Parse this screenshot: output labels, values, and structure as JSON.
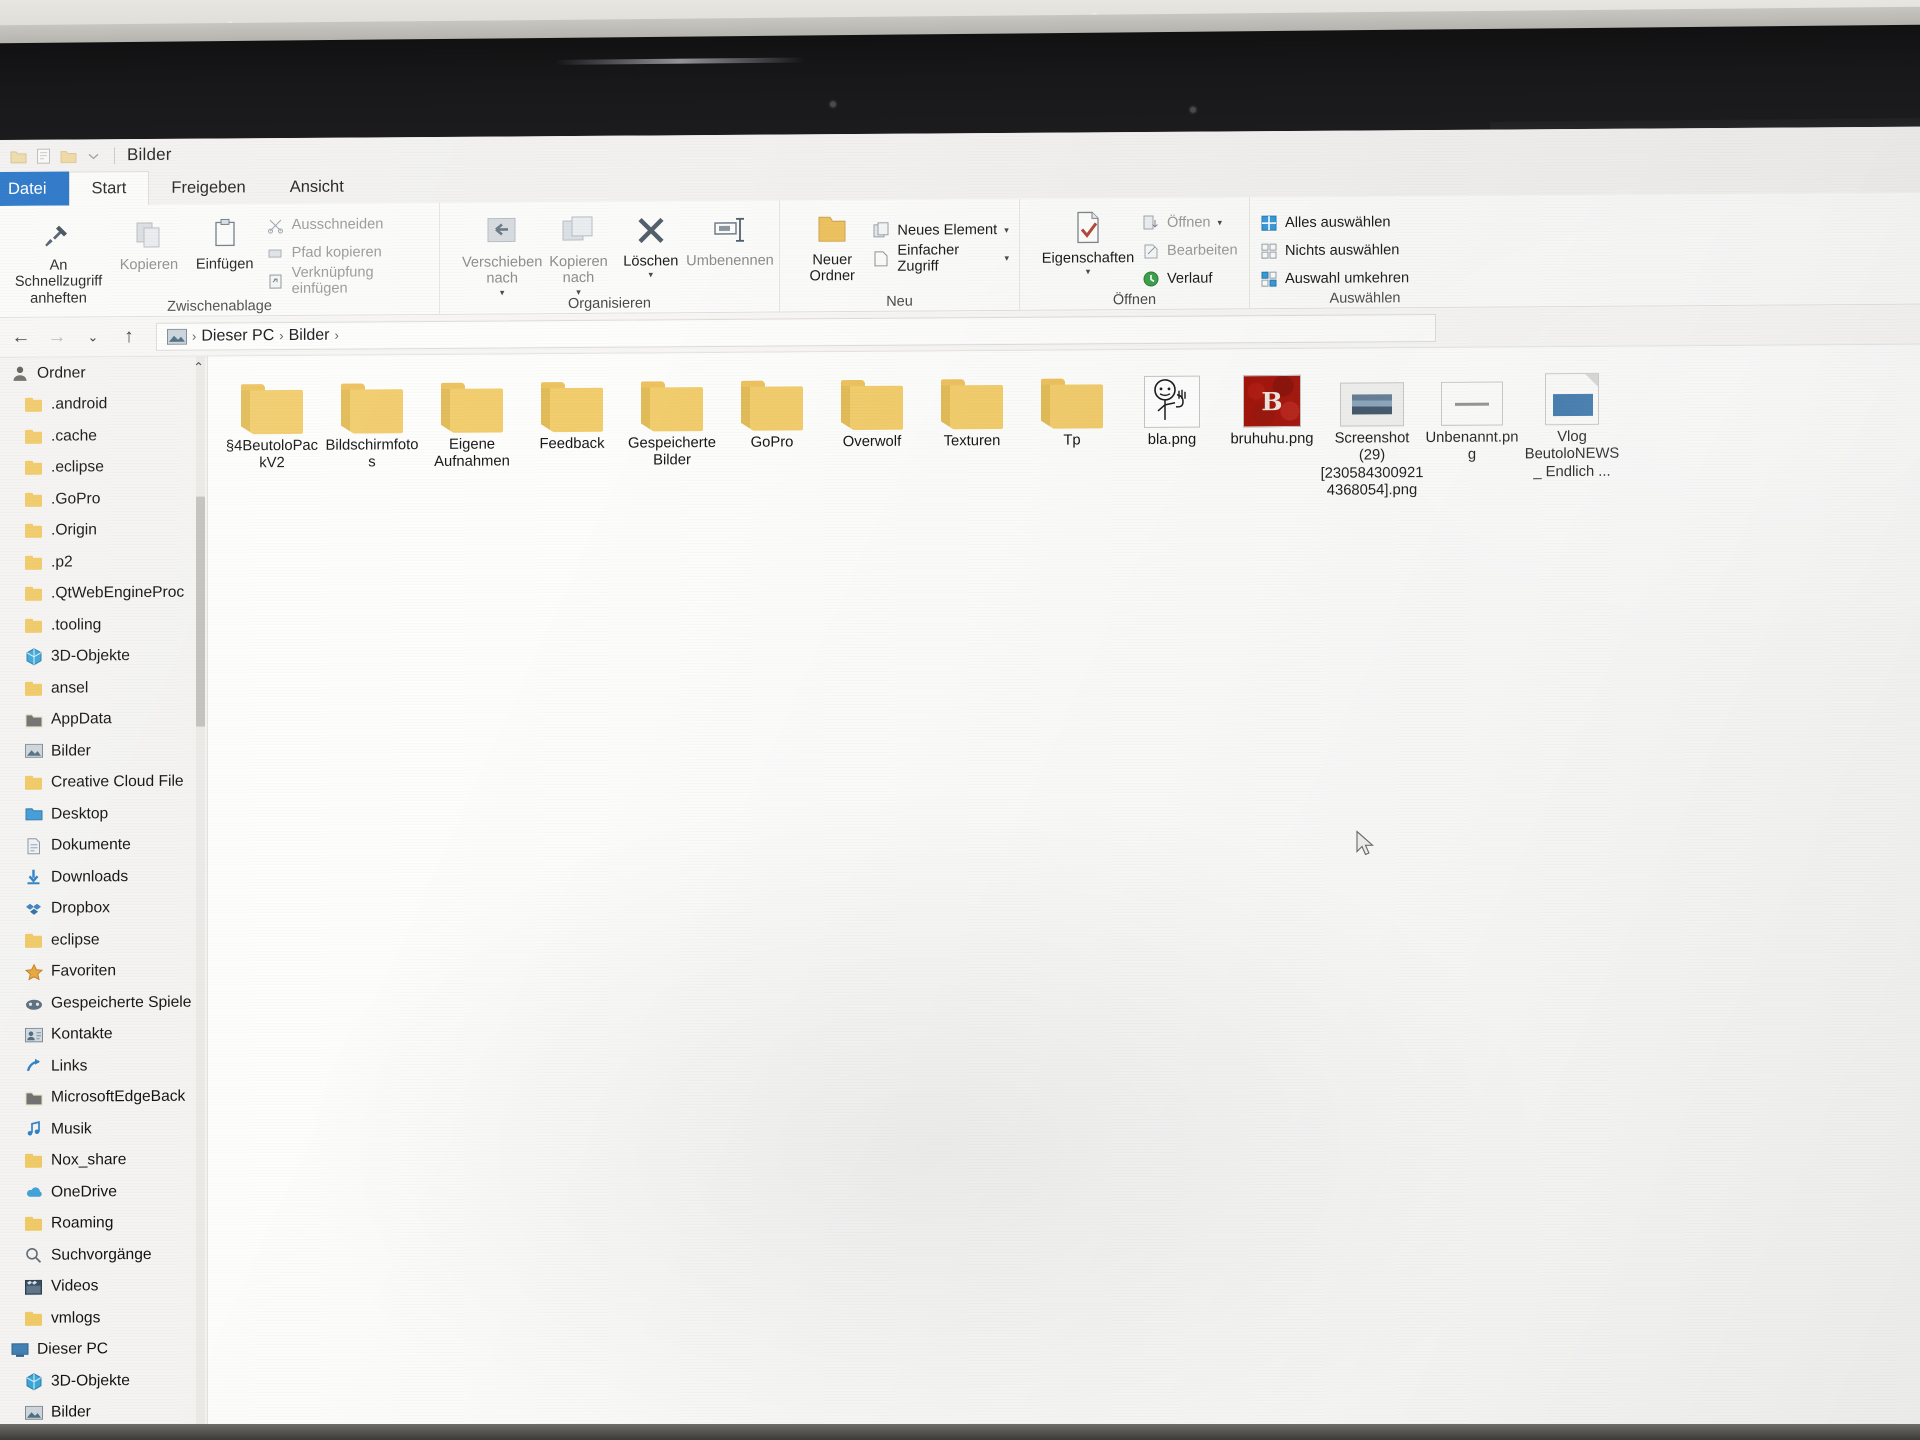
{
  "window": {
    "title": "Bilder",
    "qat_icons": [
      "folder-icon",
      "properties-icon",
      "new-folder-icon",
      "dropdown-caret-icon"
    ]
  },
  "tabs": [
    {
      "label": "Datei",
      "state": "file"
    },
    {
      "label": "Start",
      "state": "active"
    },
    {
      "label": "Freigeben",
      "state": "normal"
    },
    {
      "label": "Ansicht",
      "state": "normal"
    }
  ],
  "ribbon": {
    "groups": [
      {
        "label": "Zwischenablage",
        "big": [
          {
            "label": "An Schnellzugriff anheften",
            "icon": "pin-icon",
            "disabled": false
          },
          {
            "label": "Kopieren",
            "icon": "copy-icon",
            "disabled": true
          },
          {
            "label": "Einfügen",
            "icon": "paste-icon",
            "disabled": false
          }
        ],
        "small": [
          {
            "label": "Ausschneiden",
            "icon": "scissors-icon",
            "disabled": true
          },
          {
            "label": "Pfad kopieren",
            "icon": "copy-path-icon",
            "disabled": true
          },
          {
            "label": "Verknüpfung einfügen",
            "icon": "paste-shortcut-icon",
            "disabled": true
          }
        ]
      },
      {
        "label": "Organisieren",
        "big": [
          {
            "label": "Verschieben nach",
            "icon": "move-to-icon",
            "caret": true,
            "disabled": true
          },
          {
            "label": "Kopieren nach",
            "icon": "copy-to-icon",
            "caret": true,
            "disabled": true
          },
          {
            "label": "Löschen",
            "icon": "delete-x-icon",
            "caret": true,
            "disabled": false
          },
          {
            "label": "Umbenennen",
            "icon": "rename-icon",
            "disabled": true
          }
        ],
        "small": []
      },
      {
        "label": "Neu",
        "big": [
          {
            "label": "Neuer Ordner",
            "icon": "new-folder-icon",
            "disabled": false
          }
        ],
        "small": [
          {
            "label": "Neues Element",
            "icon": "new-item-icon",
            "caret": true,
            "disabled": false
          },
          {
            "label": "Einfacher Zugriff",
            "icon": "easy-access-icon",
            "caret": true,
            "disabled": false
          }
        ]
      },
      {
        "label": "Öffnen",
        "big": [
          {
            "label": "Eigenschaften",
            "icon": "properties-check-icon",
            "caret": true,
            "disabled": false
          }
        ],
        "small": [
          {
            "label": "Öffnen",
            "icon": "open-icon",
            "caret": true,
            "disabled": true
          },
          {
            "label": "Bearbeiten",
            "icon": "edit-icon",
            "disabled": true
          },
          {
            "label": "Verlauf",
            "icon": "history-icon",
            "disabled": false
          }
        ]
      },
      {
        "label": "Auswählen",
        "big": [],
        "small": [
          {
            "label": "Alles auswählen",
            "icon": "select-all-icon",
            "disabled": false
          },
          {
            "label": "Nichts auswählen",
            "icon": "select-none-icon",
            "disabled": false
          },
          {
            "label": "Auswahl umkehren",
            "icon": "invert-selection-icon",
            "disabled": false
          }
        ]
      }
    ]
  },
  "address_bar": {
    "back_icon": "back-arrow-icon",
    "forward_icon": "forward-arrow-icon",
    "recent_icon": "recent-locations-caret-icon",
    "up_icon": "up-arrow-icon",
    "location_icon": "pictures-icon",
    "crumbs": [
      "Dieser PC",
      "Bilder"
    ],
    "separator": "›"
  },
  "nav_pane": {
    "root_label": "Ordner",
    "root_icon": "user-folder-icon",
    "items": [
      {
        "label": ".android",
        "icon": "folder-icon"
      },
      {
        "label": ".cache",
        "icon": "folder-icon"
      },
      {
        "label": ".eclipse",
        "icon": "folder-icon"
      },
      {
        "label": ".GoPro",
        "icon": "folder-icon"
      },
      {
        "label": ".Origin",
        "icon": "folder-icon"
      },
      {
        "label": ".p2",
        "icon": "folder-icon"
      },
      {
        "label": ".QtWebEngineProc",
        "icon": "folder-icon"
      },
      {
        "label": ".tooling",
        "icon": "folder-icon"
      },
      {
        "label": "3D-Objekte",
        "icon": "3d-objects-icon"
      },
      {
        "label": "ansel",
        "icon": "folder-icon"
      },
      {
        "label": "AppData",
        "icon": "folder-hidden-icon"
      },
      {
        "label": "Bilder",
        "icon": "pictures-icon"
      },
      {
        "label": "Creative Cloud File",
        "icon": "folder-icon"
      },
      {
        "label": "Desktop",
        "icon": "desktop-icon"
      },
      {
        "label": "Dokumente",
        "icon": "documents-icon"
      },
      {
        "label": "Downloads",
        "icon": "downloads-icon"
      },
      {
        "label": "Dropbox",
        "icon": "dropbox-icon"
      },
      {
        "label": "eclipse",
        "icon": "folder-icon"
      },
      {
        "label": "Favoriten",
        "icon": "favorites-star-icon"
      },
      {
        "label": "Gespeicherte Spiele",
        "icon": "saved-games-icon"
      },
      {
        "label": "Kontakte",
        "icon": "contacts-icon"
      },
      {
        "label": "Links",
        "icon": "links-icon"
      },
      {
        "label": "MicrosoftEdgeBack",
        "icon": "folder-hidden-icon"
      },
      {
        "label": "Musik",
        "icon": "music-icon"
      },
      {
        "label": "Nox_share",
        "icon": "folder-icon"
      },
      {
        "label": "OneDrive",
        "icon": "onedrive-icon"
      },
      {
        "label": "Roaming",
        "icon": "folder-icon"
      },
      {
        "label": "Suchvorgänge",
        "icon": "searches-icon"
      },
      {
        "label": "Videos",
        "icon": "videos-icon"
      },
      {
        "label": "vmlogs",
        "icon": "folder-icon"
      },
      {
        "label": "Dieser PC",
        "icon": "this-pc-icon"
      },
      {
        "label": "3D-Objekte",
        "icon": "3d-objects-icon"
      },
      {
        "label": "Bilder",
        "icon": "pictures-icon"
      }
    ]
  },
  "content": {
    "items": [
      {
        "name": "§4BeutoloPackV2",
        "kind": "folder"
      },
      {
        "name": "Bildschirmfotos",
        "kind": "folder"
      },
      {
        "name": "Eigene Aufnahmen",
        "kind": "folder"
      },
      {
        "name": "Feedback",
        "kind": "folder"
      },
      {
        "name": "Gespeicherte Bilder",
        "kind": "folder"
      },
      {
        "name": "GoPro",
        "kind": "folder"
      },
      {
        "name": "Overwolf",
        "kind": "folder"
      },
      {
        "name": "Texturen",
        "kind": "folder"
      },
      {
        "name": "Tp",
        "kind": "folder"
      },
      {
        "name": "bla.png",
        "kind": "image-sketch"
      },
      {
        "name": "bruhuhu.png",
        "kind": "image-red",
        "glyph": "B"
      },
      {
        "name": "Screenshot (29)[2305843009214368054].png",
        "kind": "image-screenshot"
      },
      {
        "name": "Unbenannt.png",
        "kind": "image-blank"
      },
      {
        "name": "Vlog BeutoloNEWS _ Endlich ...",
        "kind": "image-vlog"
      }
    ]
  },
  "colors": {
    "accent": "#1f6fc4",
    "folder": "#f2cd6d",
    "ribbon_bg": "#fbfbfa",
    "navpane_bg": "#f4f3f1",
    "content_bg": "#fdfdfc",
    "red_thumb": "#a3140b"
  }
}
